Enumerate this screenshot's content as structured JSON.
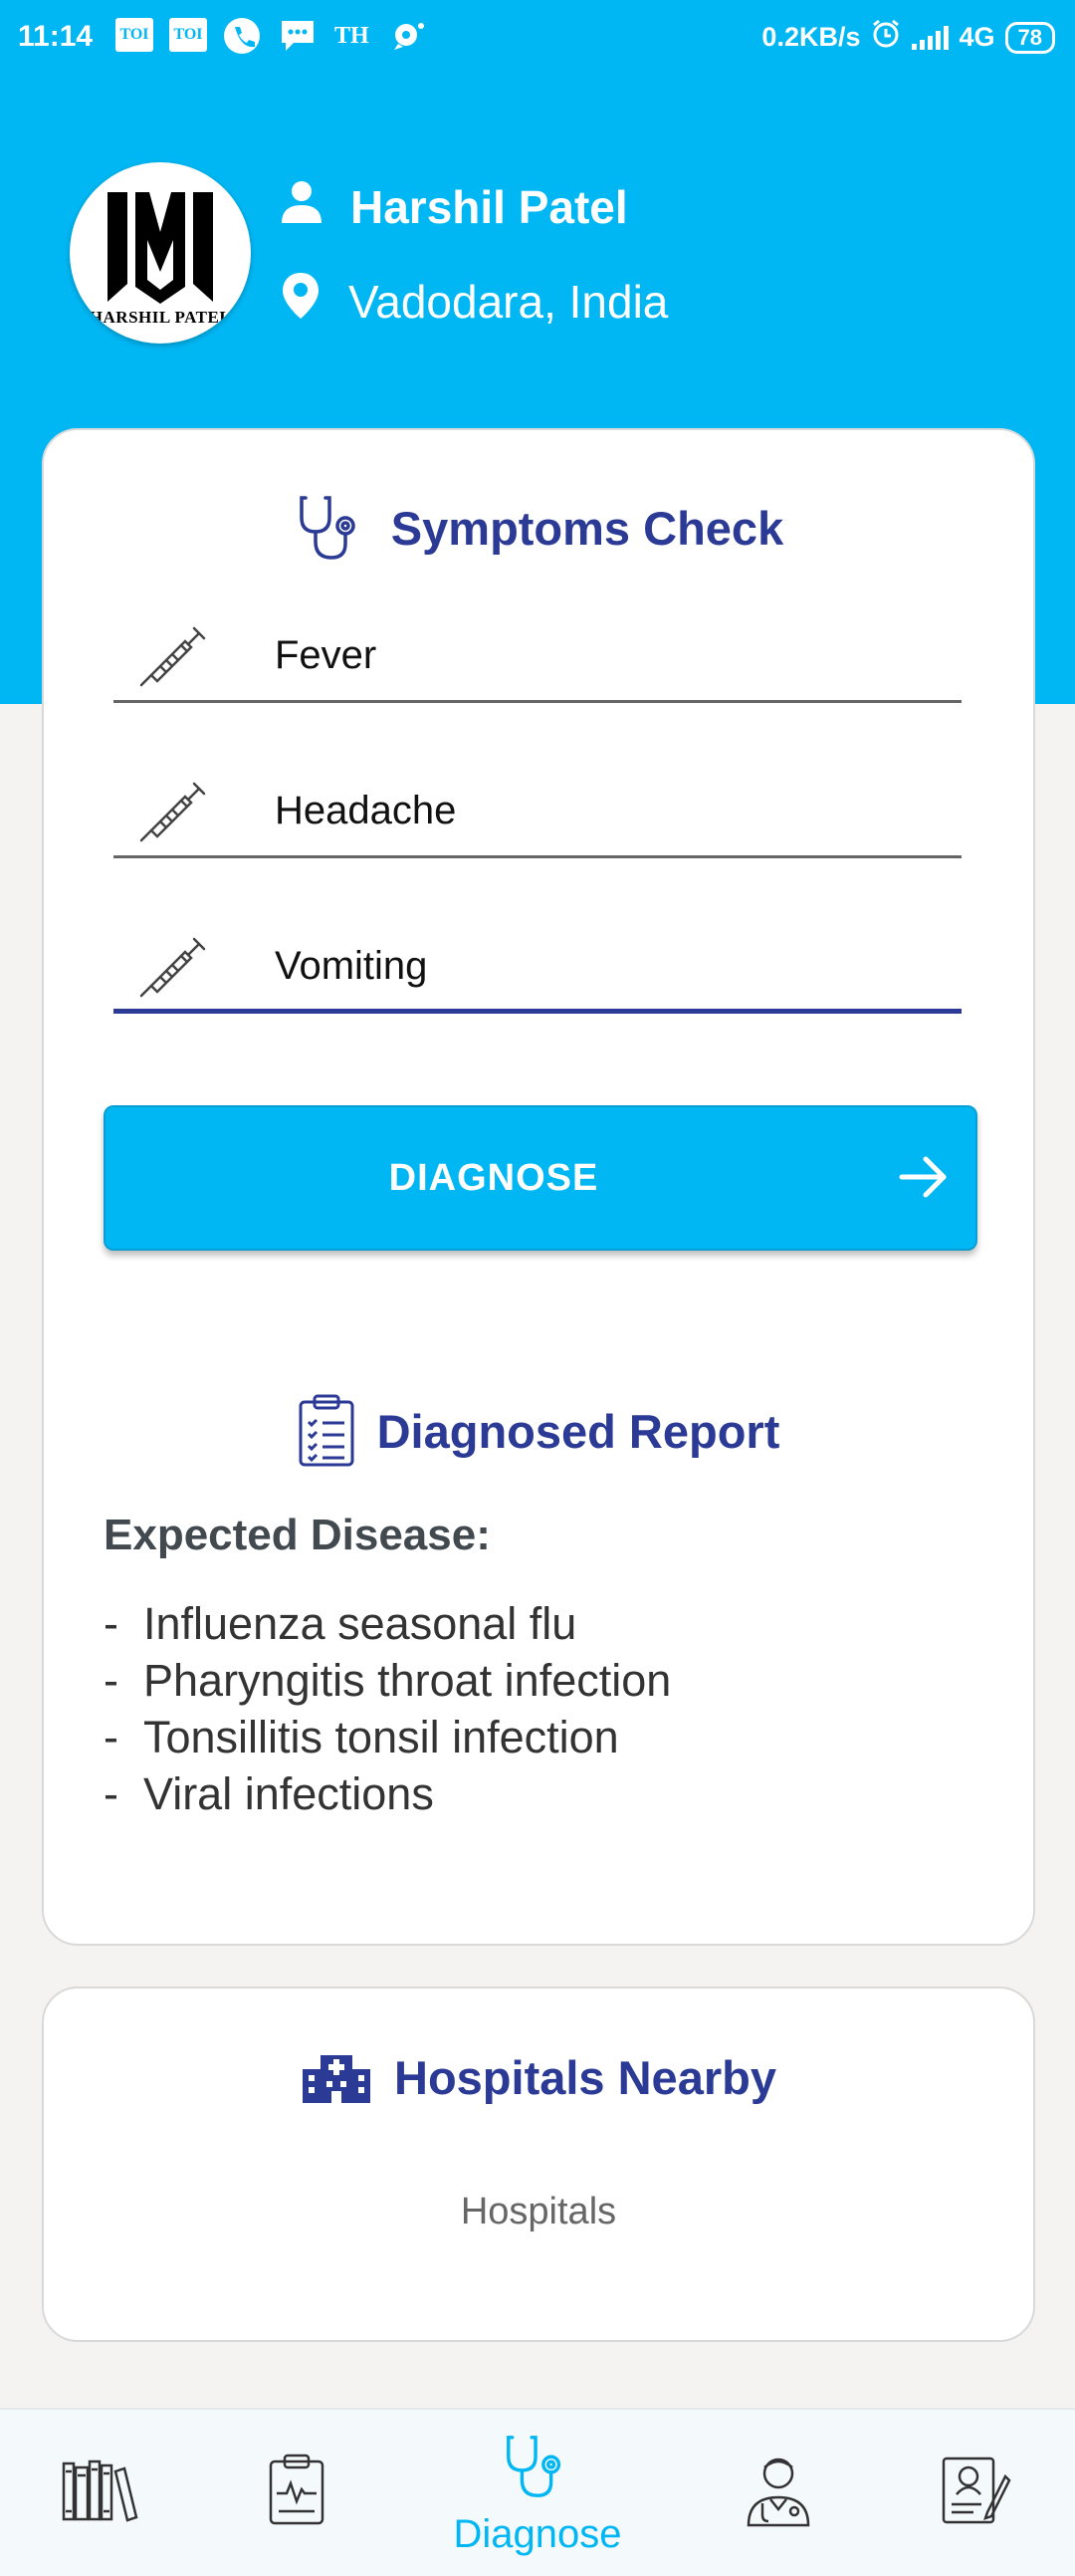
{
  "status_bar": {
    "time": "11:14",
    "notif_toi_1": "TOI",
    "notif_toi_2": "TOI",
    "notif_th": "TH",
    "net_speed": "0.2KB/s",
    "network": "4G",
    "battery": "78"
  },
  "profile": {
    "avatar_logo_text": "HARSHIL PATEL",
    "name": "Harshil Patel",
    "location": "Vadodara, India",
    "user_icon": "person-icon",
    "location_icon": "location-pin-icon"
  },
  "symptoms_check": {
    "title": "Symptoms Check",
    "icon": "stethoscope-icon",
    "symptoms": [
      {
        "value": "Fever",
        "icon": "syringe-icon"
      },
      {
        "value": "Headache",
        "icon": "syringe-icon"
      },
      {
        "value": "Vomiting",
        "icon": "syringe-icon"
      }
    ],
    "diagnose_button": "DIAGNOSE"
  },
  "report": {
    "title": "Diagnosed Report",
    "icon": "clipboard-checklist-icon",
    "expected_label": "Expected Disease:",
    "diseases": [
      "Influenza seasonal flu",
      "Pharyngitis throat infection",
      "Tonsillitis tonsil infection",
      "Viral infections"
    ]
  },
  "hospitals": {
    "title": "Hospitals Nearby",
    "icon": "hospital-building-icon",
    "text": "Hospitals"
  },
  "bottom_nav": {
    "active_label": "Diagnose",
    "items": [
      "books-icon",
      "clipboard-ecg-icon",
      "stethoscope-icon",
      "doctor-icon",
      "medical-record-icon"
    ]
  },
  "colors": {
    "primary": "#00b7f4",
    "title_blue": "#2b3a95",
    "background": "#f5f3f2"
  }
}
